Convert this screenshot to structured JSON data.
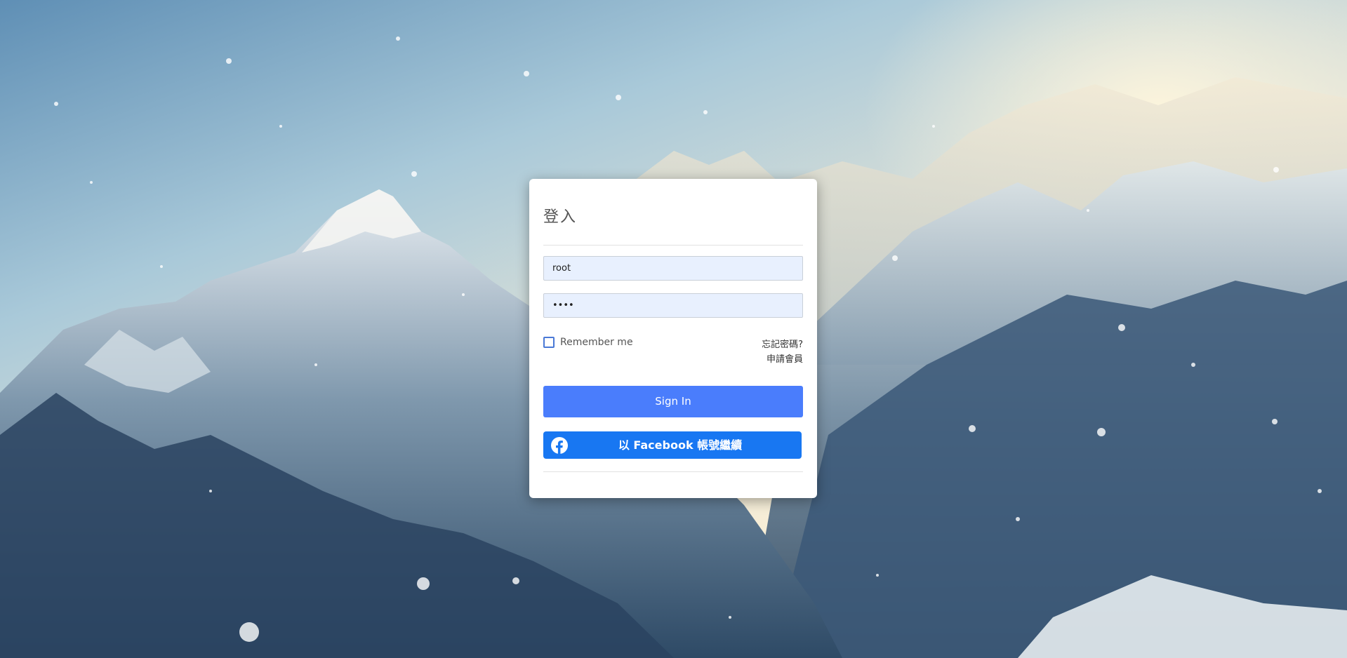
{
  "login": {
    "title": "登入",
    "username_value": "root",
    "password_value": "••••",
    "remember_label": "Remember me",
    "forgot_password": "忘記密碼?",
    "register": "申請會員",
    "signin_label": "Sign In",
    "facebook_label": "以 Facebook 帳號繼續"
  },
  "colors": {
    "signin_button": "#4a7dfc",
    "facebook_button": "#1877f2",
    "input_background": "#e8f0fe"
  },
  "icons": {
    "facebook": "facebook-icon"
  }
}
